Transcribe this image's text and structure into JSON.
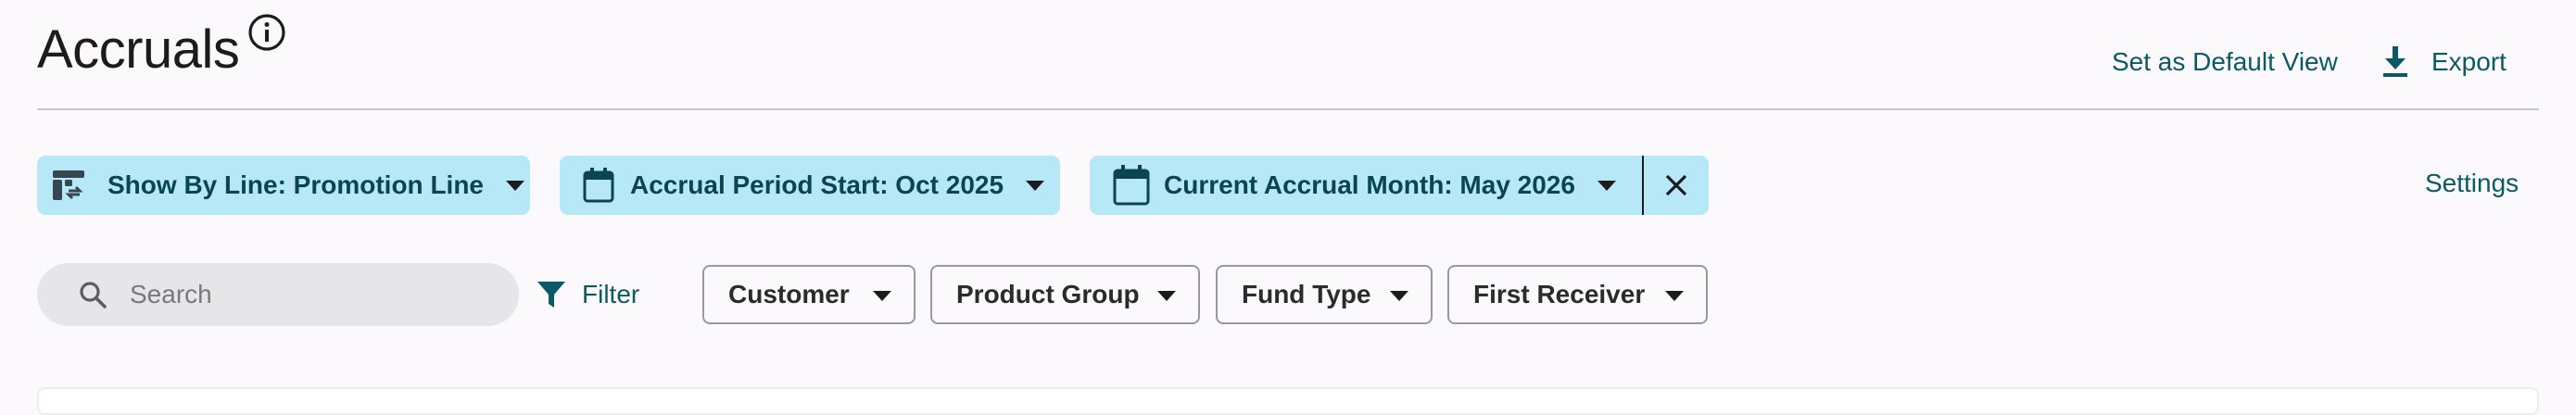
{
  "header": {
    "title": "Accruals",
    "info_icon": "info-circle-icon",
    "set_default_view": "Set as Default View",
    "export": "Export",
    "export_icon": "download-icon"
  },
  "chips": [
    {
      "label": "Show By Line: Promotion Line",
      "icon": "table-swap-icon"
    },
    {
      "label": "Accrual Period Start: Oct 2025",
      "icon": "calendar-icon"
    },
    {
      "label": "Current Accrual Month: May 2026",
      "icon": "calendar-icon",
      "clear_icon": "close-icon"
    }
  ],
  "settings": "Settings",
  "search": {
    "placeholder": "Search",
    "value": "",
    "icon": "search-icon"
  },
  "filter": {
    "label": "Filter",
    "icon": "funnel-icon"
  },
  "dropdowns": [
    {
      "label": "Customer"
    },
    {
      "label": "Product Group"
    },
    {
      "label": "Fund Type"
    },
    {
      "label": "First Receiver"
    }
  ],
  "colors": {
    "accent": "#0a5a66",
    "chip_bg": "#b7e8f7",
    "background": "#fbf9fc"
  }
}
